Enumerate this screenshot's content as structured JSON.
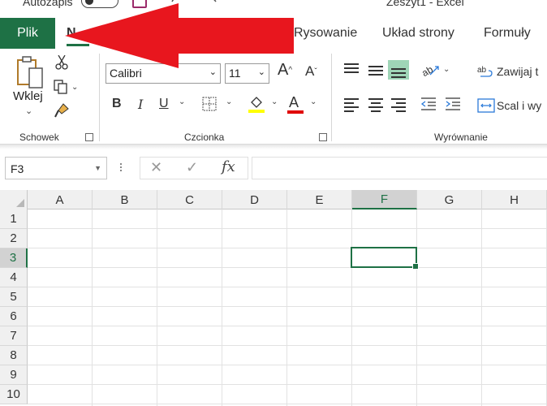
{
  "titlebar": {
    "autosave_label": "Autozapis",
    "document_title": "Zeszyt1  -  Excel"
  },
  "tabs": [
    {
      "label": "Plik"
    },
    {
      "label": "N"
    },
    {
      "label": "Rysowanie"
    },
    {
      "label": "Układ strony"
    },
    {
      "label": "Formuły"
    }
  ],
  "clipboard": {
    "paste_label": "Wklej",
    "group_label": "Schowek"
  },
  "font": {
    "font_name": "Calibri",
    "font_size": "11",
    "group_label": "Czcionka",
    "bold": "B",
    "italic": "I",
    "underline": "U",
    "grow": "A",
    "shrink": "A",
    "highlight_color": "#ffff00",
    "font_color": "#e00000"
  },
  "alignment": {
    "wrap_text": "Zawijaj t",
    "merge_center": "Scal i wy",
    "group_label": "Wyrównanie"
  },
  "formula_bar": {
    "name_box": "F3",
    "fx": "fx"
  },
  "grid": {
    "columns": [
      "A",
      "B",
      "C",
      "D",
      "E",
      "F",
      "G",
      "H"
    ],
    "rows": [
      "1",
      "2",
      "3",
      "4",
      "5",
      "6",
      "7",
      "8",
      "9",
      "10"
    ],
    "selected_column": "F",
    "selected_row": "3"
  },
  "colors": {
    "accent": "#1e7145",
    "arrow": "#e8161e"
  }
}
